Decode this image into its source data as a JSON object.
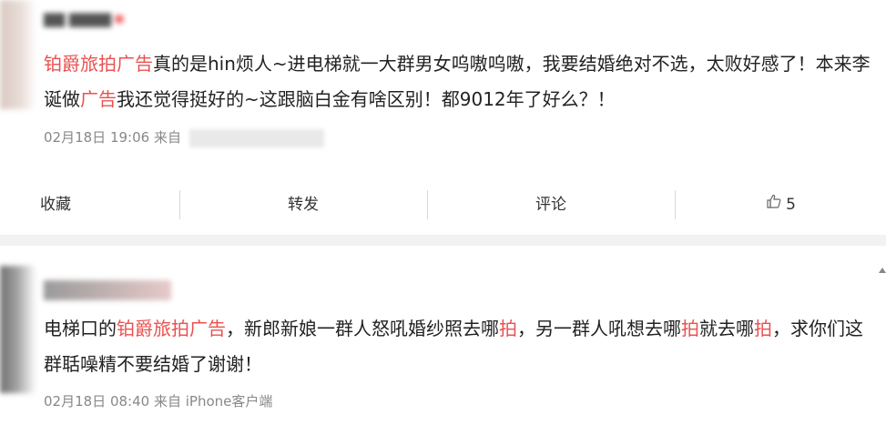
{
  "posts": [
    {
      "content_segments": [
        {
          "text": "铂爵旅拍广告",
          "hl": true
        },
        {
          "text": "真的是hin烦人~进电梯就一大群男女呜嗷呜嗷，我要结婚绝对不选，太败好感了！本来李诞做",
          "hl": false
        },
        {
          "text": "广告",
          "hl": true
        },
        {
          "text": "我还觉得挺好的~这跟脑白金有啥区别！都9012年了好么？！",
          "hl": false
        }
      ],
      "time": "02月18日 19:06",
      "from_label": "来自",
      "actions": {
        "collect": "收藏",
        "forward": "转发",
        "comment": "评论",
        "like_count": "5"
      }
    },
    {
      "content_segments": [
        {
          "text": "电梯口的",
          "hl": false
        },
        {
          "text": "铂爵旅拍广告",
          "hl": true
        },
        {
          "text": "，新郎新娘一群人怒吼婚纱照去哪",
          "hl": false
        },
        {
          "text": "拍",
          "hl": true
        },
        {
          "text": "，另一群人吼想去哪",
          "hl": false
        },
        {
          "text": "拍",
          "hl": true
        },
        {
          "text": "就去哪",
          "hl": false
        },
        {
          "text": "拍",
          "hl": true
        },
        {
          "text": "，求你们这群聒噪精不要结婚了谢谢！",
          "hl": false
        }
      ],
      "time": "02月18日 08:40",
      "from_label": "来自",
      "source": "iPhone客户端"
    }
  ],
  "colors": {
    "highlight": "#eb5050",
    "text": "#222222",
    "meta": "#888888",
    "gap": "#f2f2f5"
  },
  "icons": {
    "like": "thumbs-up-icon"
  }
}
